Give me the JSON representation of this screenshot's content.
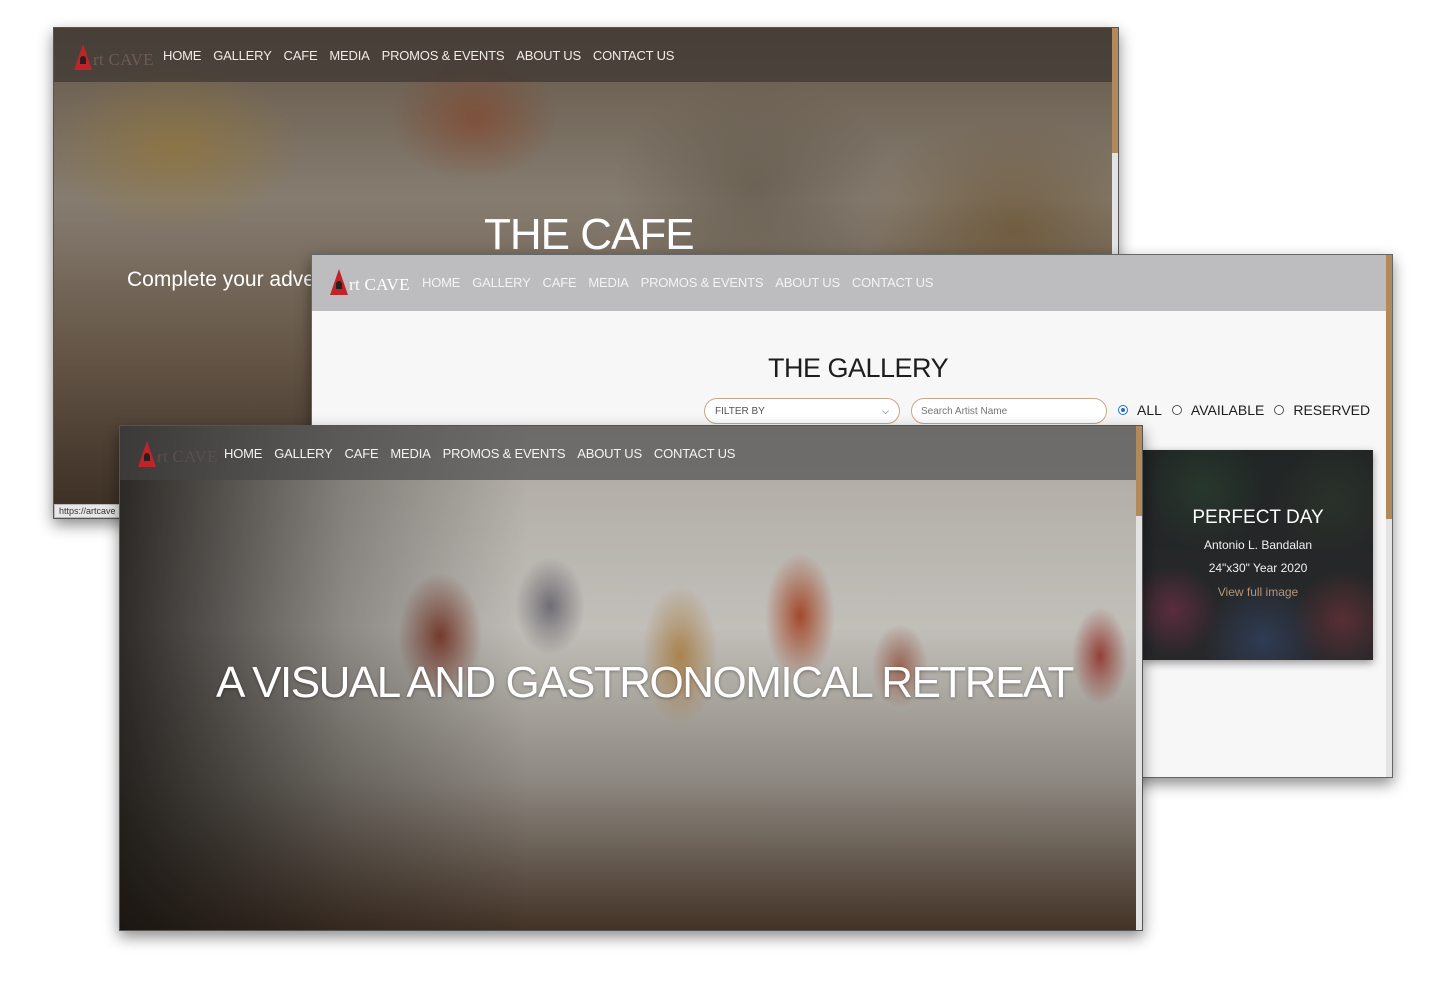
{
  "brand": {
    "logo_text": "rt CAVE"
  },
  "nav": {
    "items": [
      "HOME",
      "GALLERY",
      "CAFE",
      "MEDIA",
      "PROMOS & EVENTS",
      "ABOUT US",
      "CONTACT US"
    ]
  },
  "cafe_page": {
    "title": "THE CAFE",
    "subtitle": "Complete your adve",
    "status_url": "https://artcave"
  },
  "gallery_page": {
    "title": "THE GALLERY",
    "filter": {
      "selected": "FILTER BY"
    },
    "search": {
      "placeholder": "Search Artist Name"
    },
    "availability": {
      "options": [
        "ALL",
        "AVAILABLE",
        "RESERVED"
      ],
      "selected": "ALL"
    },
    "artwork": {
      "title": "PERFECT DAY",
      "artist": "Antonio L. Bandalan",
      "details": "24\"x30\" Year 2020",
      "link_label": "View full image"
    }
  },
  "home_page": {
    "hero_title": "A VISUAL AND GASTRONOMICAL RETREAT"
  },
  "colors": {
    "accent": "#b08a5a",
    "logo_red": "#c0242b",
    "radio_selected": "#1a6fd8"
  }
}
